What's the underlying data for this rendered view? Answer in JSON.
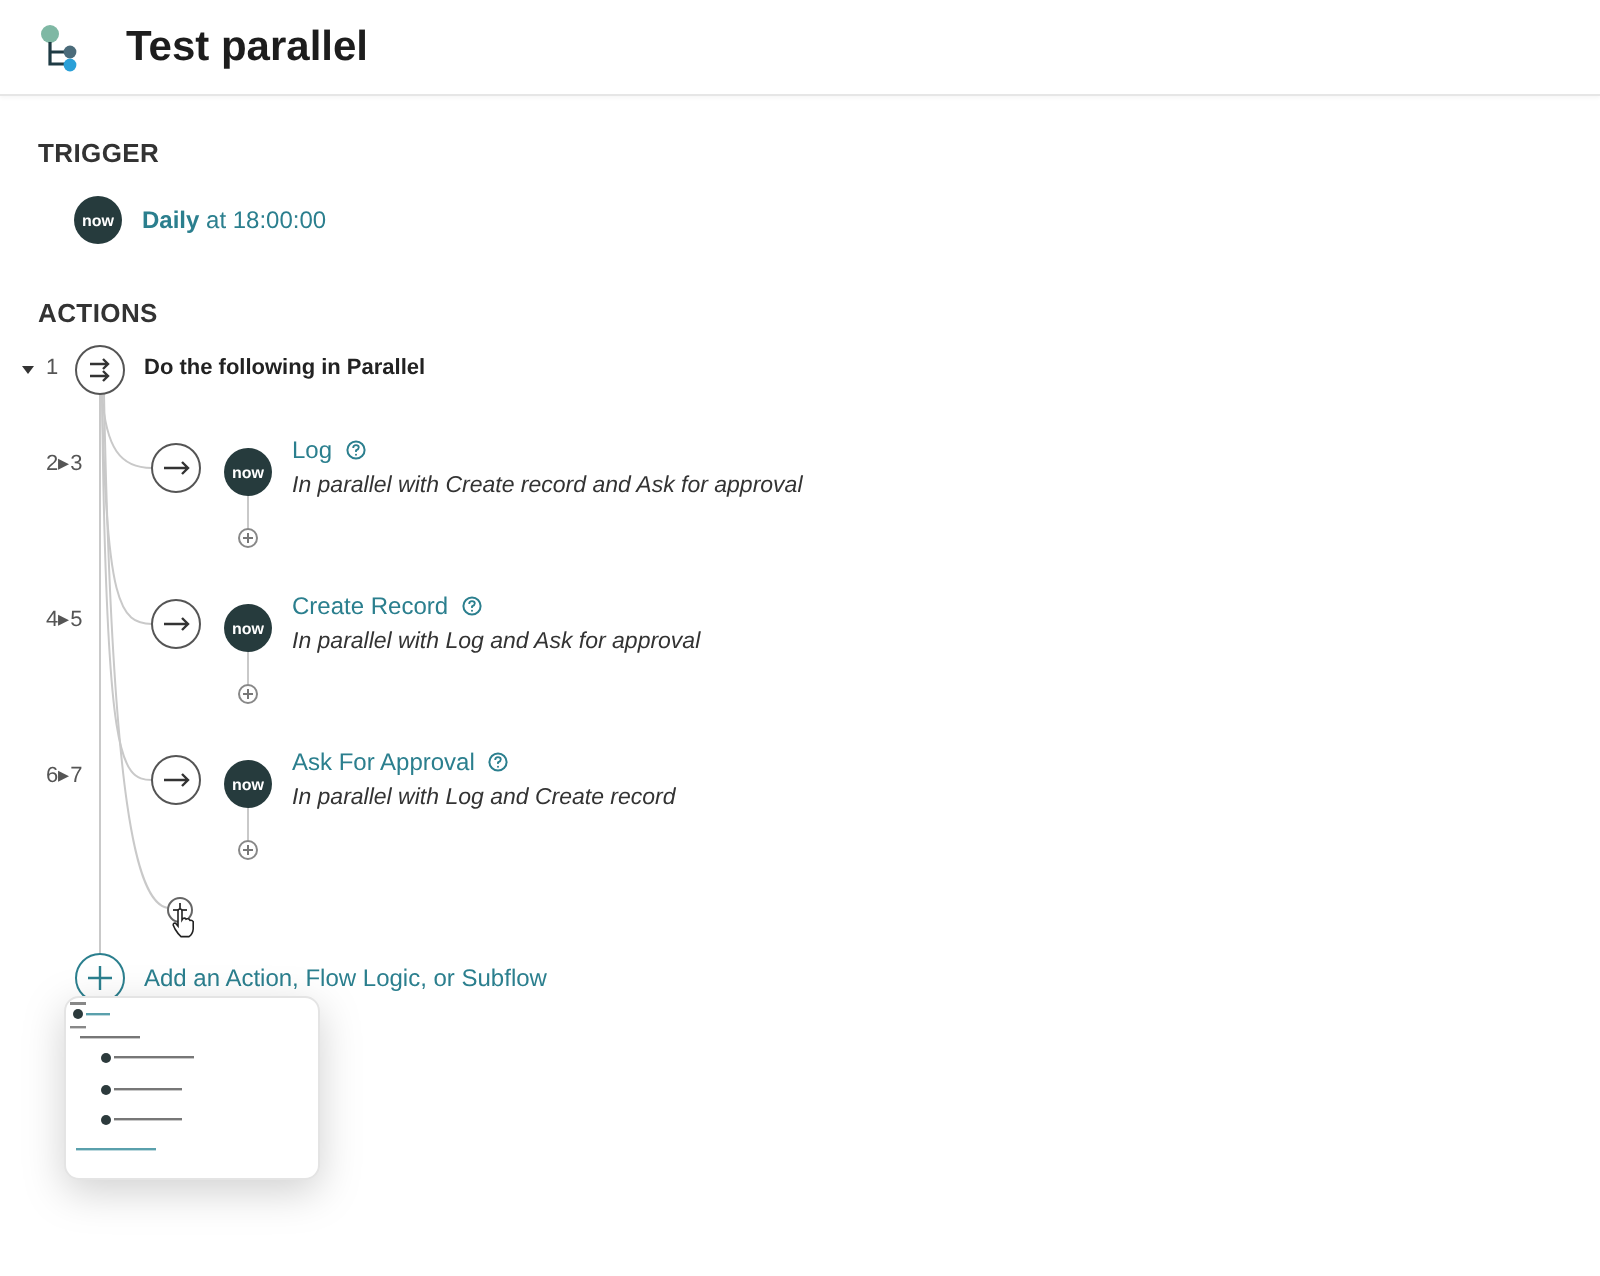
{
  "header": {
    "title": "Test parallel"
  },
  "trigger": {
    "heading": "TRIGGER",
    "badge": "now",
    "name": "Daily",
    "detail": "at 18:00:00"
  },
  "actions": {
    "heading": "ACTIONS",
    "flow_logic": {
      "number": "1",
      "expanded": true,
      "label": "Do the following in Parallel",
      "branches": [
        {
          "steps": "2▸3",
          "badge": "now",
          "title": "Log",
          "description": "In parallel with Create record and Ask for approval"
        },
        {
          "steps": "4▸5",
          "badge": "now",
          "title": "Create Record",
          "description": "In parallel with Log and Ask for approval"
        },
        {
          "steps": "6▸7",
          "badge": "now",
          "title": "Ask For Approval",
          "description": "In parallel with Log and Create record"
        }
      ]
    },
    "add_label": "Add an Action, Flow Logic, or Subflow"
  }
}
